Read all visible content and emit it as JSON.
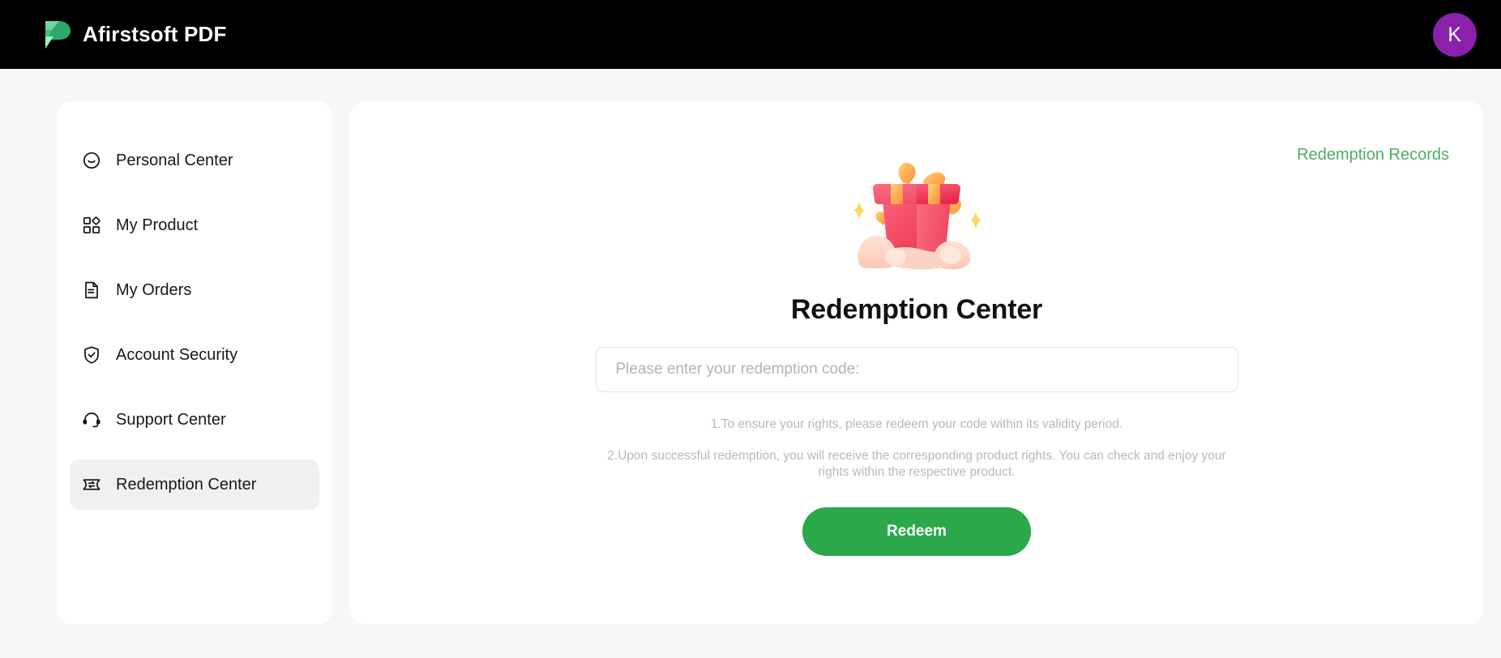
{
  "header": {
    "brand_name": "Afirstsoft PDF",
    "logo_icon": "afirstsoft-leaf-logo",
    "avatar_initial": "K",
    "avatar_color": "#8a21ad",
    "background_color": "#000000"
  },
  "sidebar": {
    "items": [
      {
        "label": "Personal Center",
        "icon": "smiley-face-icon",
        "active": false
      },
      {
        "label": "My Product",
        "icon": "grid-blocks-icon",
        "active": false
      },
      {
        "label": "My Orders",
        "icon": "document-icon",
        "active": false
      },
      {
        "label": "Account Security",
        "icon": "shield-check-icon",
        "active": false
      },
      {
        "label": "Support Center",
        "icon": "headset-icon",
        "active": false
      },
      {
        "label": "Redemption Center",
        "icon": "ticket-exchange-icon",
        "active": true
      }
    ]
  },
  "main": {
    "records_link": "Redemption Records",
    "records_link_color": "#4caf62",
    "illustration": "hands-holding-gift-box-illustration",
    "title": "Redemption Center",
    "input": {
      "placeholder": "Please enter your redemption code:",
      "value": ""
    },
    "notes": [
      "1.To ensure your rights, please redeem your code within its validity period.",
      "2.Upon successful redemption, you will receive the corresponding product rights. You can check and enjoy your rights within the respective product."
    ],
    "redeem_label": "Redeem",
    "redeem_color": "#2ba84a"
  }
}
